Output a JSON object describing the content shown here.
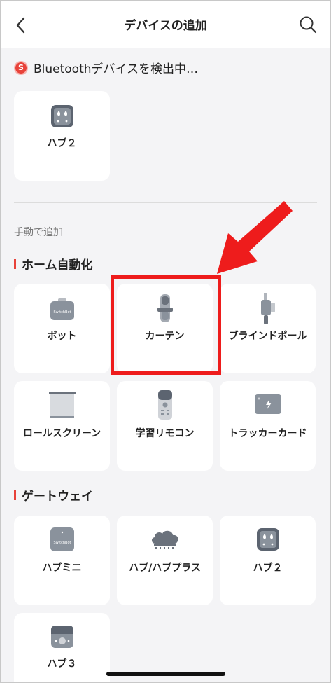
{
  "header": {
    "title": "デバイスの追加",
    "back_icon": "chevron-left-icon",
    "search_icon": "search-icon"
  },
  "bluetooth": {
    "badge": "S",
    "status_text": "Bluetoothデバイスを検出中…",
    "devices": [
      {
        "label": "ハブ２",
        "icon": "hub2-icon"
      }
    ]
  },
  "manual": {
    "label": "手動で追加"
  },
  "sections": [
    {
      "title": "ホーム自動化",
      "items": [
        {
          "label": "ボット",
          "icon": "bot-icon"
        },
        {
          "label": "カーテン",
          "icon": "curtain-icon"
        },
        {
          "label": "ブラインドポール",
          "icon": "blind-tilt-icon"
        },
        {
          "label": "ロールスクリーン",
          "icon": "roller-shade-icon"
        },
        {
          "label": "学習リモコン",
          "icon": "remote-icon"
        },
        {
          "label": "トラッカーカード",
          "icon": "tracker-card-icon"
        }
      ]
    },
    {
      "title": "ゲートウェイ",
      "items": [
        {
          "label": "ハブミニ",
          "icon": "hub-mini-icon"
        },
        {
          "label": "ハブ/ハブプラス",
          "icon": "cloud-hub-icon"
        },
        {
          "label": "ハブ２",
          "icon": "hub2-icon"
        },
        {
          "label": "ハブ３",
          "icon": "hub3-icon"
        }
      ]
    }
  ],
  "colors": {
    "accent": "#e8423a",
    "highlight": "#ee1c1c",
    "background": "#f4f4f6",
    "card": "#ffffff"
  }
}
